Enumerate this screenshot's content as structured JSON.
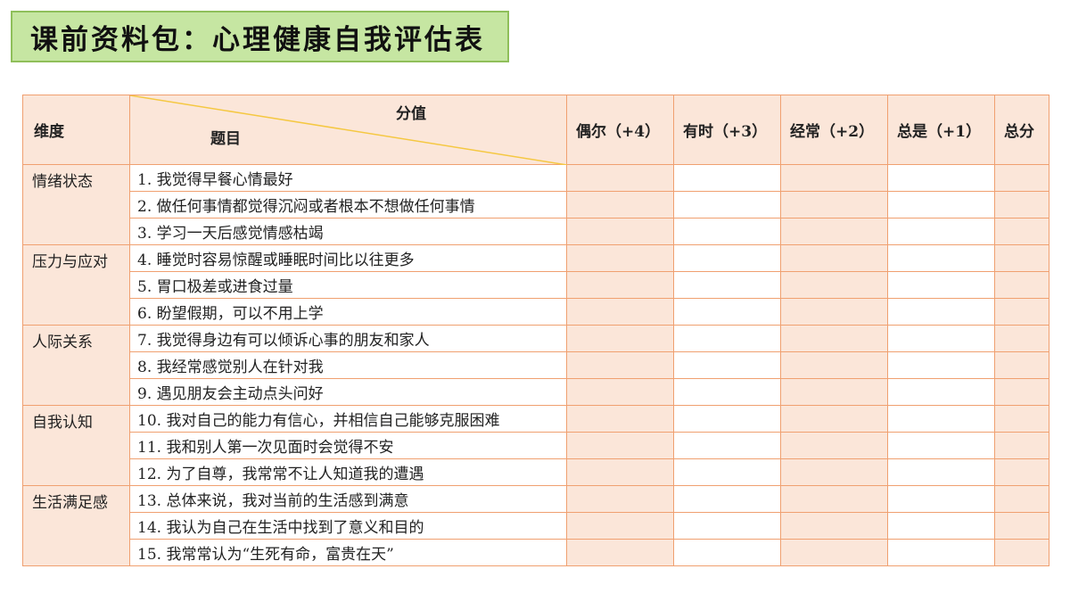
{
  "title": "课前资料包：心理健康自我评估表",
  "header": {
    "dimension": "维度",
    "score": "分值",
    "topic": "题目",
    "columns": [
      "偶尔（+4）",
      "有时（+3）",
      "经常（+2）",
      "总是（+1）",
      "总分"
    ]
  },
  "groups": [
    {
      "dimension": "情绪状态",
      "items": [
        "1. 我觉得早餐心情最好",
        "2. 做任何事情都觉得沉闷或者根本不想做任何事情",
        "3. 学习一天后感觉情感枯竭"
      ]
    },
    {
      "dimension": "压力与应对",
      "items": [
        "4. 睡觉时容易惊醒或睡眠时间比以往更多",
        "5. 胃口极差或进食过量",
        "6. 盼望假期，可以不用上学"
      ]
    },
    {
      "dimension": "人际关系",
      "items": [
        "7. 我觉得身边有可以倾诉心事的朋友和家人",
        "8. 我经常感觉别人在针对我",
        "9. 遇见朋友会主动点头问好"
      ]
    },
    {
      "dimension": "自我认知",
      "items": [
        "10. 我对自己的能力有信心，并相信自己能够克服困难",
        "11. 我和别人第一次见面时会觉得不安",
        "12. 为了自尊，我常常不让人知道我的遭遇"
      ]
    },
    {
      "dimension": "生活满足感",
      "items": [
        "13. 总体来说，我对当前的生活感到满意",
        "14. 我认为自己在生活中找到了意义和目的",
        "15. 我常常认为“生死有命，富贵在天”"
      ]
    }
  ],
  "colors": {
    "title_bg": "#c6e6a2",
    "title_border": "#8fbf5a",
    "cell_peach": "#fbe6d9",
    "border": "#f0a070",
    "diagonal": "#f5c842"
  }
}
